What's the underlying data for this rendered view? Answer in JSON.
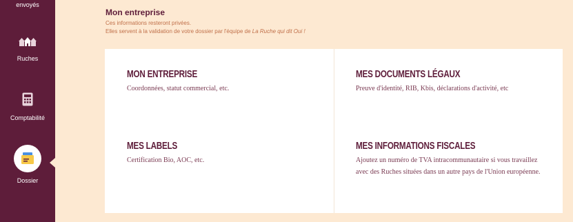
{
  "sidebar": {
    "items": [
      {
        "label": "envoyés",
        "icon": "sent-icon"
      },
      {
        "label": "Ruches",
        "icon": "beehive-icon"
      },
      {
        "label": "Comptabilité",
        "icon": "calculator-icon"
      },
      {
        "label": "Dossier",
        "icon": "folder-icon",
        "active": true
      }
    ]
  },
  "header": {
    "title": "Mon entreprise",
    "line1": "Ces informations resteront privées.",
    "line2_prefix": "Elles servent à la validation de votre dossier par l'équipe de ",
    "line2_brand": "La Ruche qui dit Oui !"
  },
  "blocks": [
    {
      "title": "Mon entreprise",
      "desc": "Coordonnées, statut commercial, etc."
    },
    {
      "title": "Mes documents légaux",
      "desc": "Preuve d'identité, RIB, Kbis, déclarations d'activité, etc"
    },
    {
      "title": "Mes labels",
      "desc": "Certification Bio, AOC, etc."
    },
    {
      "title": "Mes informations fiscales",
      "desc": "Ajoutez un numéro de TVA intracommunautaire si vous travaillez avec des Ruches situées dans un autre pays de l'Union européenne."
    }
  ],
  "colors": {
    "sidebar": "#5e1d3a",
    "background": "#fde9d2",
    "accent": "#f7c948"
  }
}
